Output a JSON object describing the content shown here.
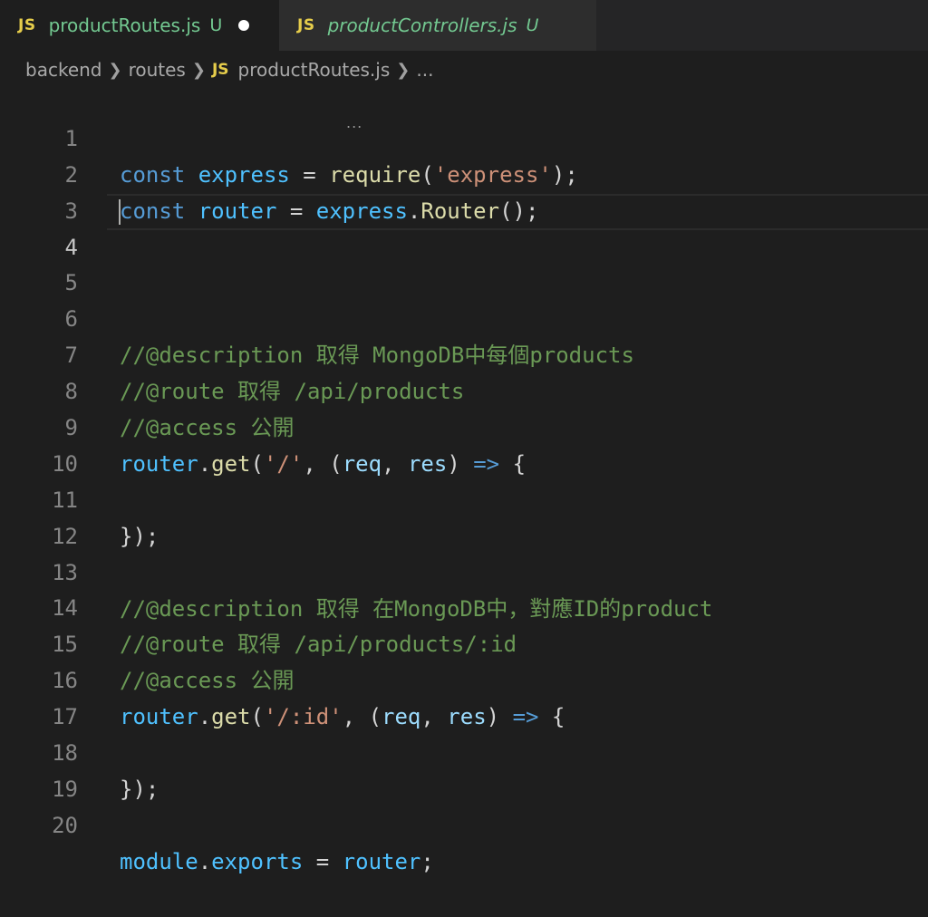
{
  "tabs": [
    {
      "icon": "JS",
      "name": "productRoutes.js",
      "status": "U",
      "dirty": true
    },
    {
      "icon": "JS",
      "name": "productControllers.js",
      "status": "U"
    }
  ],
  "breadcrumb": {
    "items": [
      "backend",
      "routes",
      "productRoutes.js",
      "..."
    ],
    "file_icon": "JS"
  },
  "editor": {
    "current_line": 4,
    "hint": "...",
    "lines": [
      {
        "n": "1"
      },
      {
        "n": "2"
      },
      {
        "n": "3"
      },
      {
        "n": "4"
      },
      {
        "n": "5"
      },
      {
        "n": "6"
      },
      {
        "n": "7"
      },
      {
        "n": "8"
      },
      {
        "n": "9"
      },
      {
        "n": "10"
      },
      {
        "n": "11"
      },
      {
        "n": "12"
      },
      {
        "n": "13"
      },
      {
        "n": "14"
      },
      {
        "n": "15"
      },
      {
        "n": "16"
      },
      {
        "n": "17"
      },
      {
        "n": "18"
      },
      {
        "n": "19"
      },
      {
        "n": "20"
      }
    ],
    "code": {
      "l1": [
        "const",
        " ",
        "express",
        " = ",
        "require",
        "(",
        "'express'",
        ");"
      ],
      "l2": [
        "const",
        " ",
        "router",
        " = ",
        "express",
        ".",
        "Router",
        "();"
      ],
      "l6": "//@description 取得 MongoDB中每個products",
      "l7": "//@route 取得 /api/products",
      "l8": "//@access 公開",
      "l9": [
        "router",
        ".",
        "get",
        "(",
        "'/'",
        ", (",
        "req",
        ", ",
        "res",
        ") ",
        "=>",
        " {"
      ],
      "l11": "});",
      "l13": "//@description 取得 在MongoDB中，對應ID的product",
      "l14": "//@route 取得 /api/products/:id",
      "l15": "//@access 公開",
      "l16": [
        "router",
        ".",
        "get",
        "(",
        "'/:id'",
        ", (",
        "req",
        ", ",
        "res",
        ") ",
        "=>",
        " {"
      ],
      "l18": "});",
      "l20": [
        "module",
        ".",
        "exports",
        " = ",
        "router",
        ";"
      ]
    }
  },
  "colors": {
    "keyword": "#569cd6",
    "variable": "#9cdcfe",
    "function": "#dcdcaa",
    "string": "#ce9178",
    "comment": "#6a9955",
    "untracked": "#73c991",
    "js_icon": "#e6cd4b"
  }
}
